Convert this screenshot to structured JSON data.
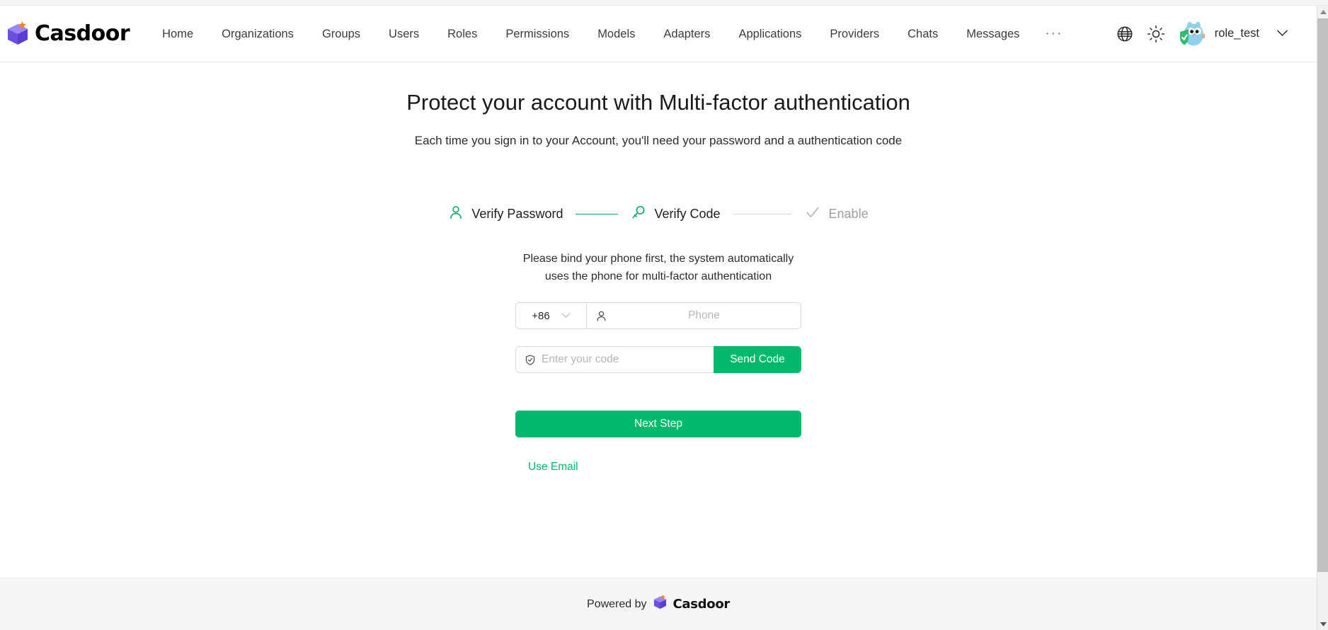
{
  "brand": {
    "name": "Casdoor",
    "logo_icon": "casdoor-cube-logo",
    "cube_color": "#7a5cf0",
    "star_color": "#f58220"
  },
  "header": {
    "nav_items": [
      {
        "label": "Home",
        "icon": "nav-item-home"
      },
      {
        "label": "Organizations",
        "icon": "nav-item-organizations"
      },
      {
        "label": "Groups",
        "icon": "nav-item-groups"
      },
      {
        "label": "Users",
        "icon": "nav-item-users"
      },
      {
        "label": "Roles",
        "icon": "nav-item-roles"
      },
      {
        "label": "Permissions",
        "icon": "nav-item-permissions"
      },
      {
        "label": "Models",
        "icon": "nav-item-models"
      },
      {
        "label": "Adapters",
        "icon": "nav-item-adapters"
      },
      {
        "label": "Applications",
        "icon": "nav-item-applications"
      },
      {
        "label": "Providers",
        "icon": "nav-item-providers"
      },
      {
        "label": "Chats",
        "icon": "nav-item-chats"
      },
      {
        "label": "Messages",
        "icon": "nav-item-messages"
      }
    ],
    "more_label": "···",
    "language_icon": "globe-icon",
    "theme_icon": "sun-icon",
    "avatar_icon": "gopher-avatar-with-shield-badge",
    "username": "role_test",
    "user_caret_icon": "chevron-down-icon"
  },
  "main": {
    "title": "Protect your account with Multi-factor authentication",
    "subtitle": "Each time you sign in to your Account, you'll need your password and a authentication code",
    "steps": [
      {
        "label": "Verify Password",
        "icon": "user-icon",
        "state": "done"
      },
      {
        "label": "Verify Code",
        "icon": "key-icon",
        "state": "active"
      },
      {
        "label": "Enable",
        "icon": "check-mark-icon",
        "state": "wait"
      }
    ],
    "bind_note": "Please bind your phone first, the system automatically uses the phone for multi-factor authentication",
    "country_code": "+86",
    "country_caret_icon": "chevron-down-icon",
    "phone_icon": "user-icon",
    "phone_placeholder": "Phone",
    "phone_value": "",
    "code_icon": "shield-check-icon",
    "code_placeholder": "Enter your code",
    "code_value": "",
    "send_code_label": "Send Code",
    "next_step_label": "Next Step",
    "use_email_label": "Use Email"
  },
  "footer": {
    "powered_by": "Powered by",
    "brand_name": "Casdoor",
    "logo_icon": "casdoor-cube-logo"
  },
  "colors": {
    "primary_green": "#00b96b",
    "step_line_active": "#00a760",
    "step_line_wait": "#d9d9d9",
    "border": "#d9d9d9",
    "footer_bg": "#f5f5f5"
  },
  "scrollbar": {
    "up_arrow_icon": "scroll-up-arrow-icon",
    "down_arrow_icon": "scroll-down-arrow-icon"
  }
}
